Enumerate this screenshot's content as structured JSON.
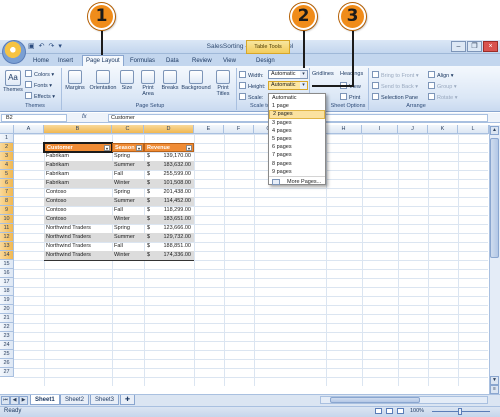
{
  "callouts": [
    "1",
    "2",
    "3"
  ],
  "window": {
    "title": "SalesSorting - Microsoft Excel",
    "context_tab": "Table Tools"
  },
  "tabs": [
    "Home",
    "Insert",
    "Page Layout",
    "Formulas",
    "Data",
    "Review",
    "View",
    "Design"
  ],
  "active_tab": "Page Layout",
  "ribbon": {
    "themes": {
      "themes_label": "Themes",
      "colors": "Colors",
      "fonts": "Fonts",
      "effects": "Effects",
      "group": "Themes"
    },
    "page_setup": {
      "margins": "Margins",
      "orientation": "Orientation",
      "size": "Size",
      "print_area": "Print Area",
      "breaks": "Breaks",
      "background": "Background",
      "print_titles": "Print Titles",
      "group": "Page Setup"
    },
    "scale": {
      "width_label": "Width:",
      "width_value": "Automatic",
      "height_label": "Height:",
      "height_value": "Automatic",
      "scale_label": "Scale:",
      "group": "Scale to Fit"
    },
    "sheet_options": {
      "gridlines": "Gridlines",
      "headings": "Headings",
      "view": "View",
      "print": "Print",
      "group": "Sheet Options"
    },
    "arrange": {
      "bring_to_front": "Bring to Front",
      "send_to_back": "Send to Back",
      "selection_pane": "Selection Pane",
      "align": "Align",
      "group_btn": "Group",
      "rotate": "Rotate",
      "group": "Arrange"
    }
  },
  "height_dropdown": {
    "items": [
      "Automatic",
      "1 page",
      "2 pages",
      "3 pages",
      "4 pages",
      "5 pages",
      "6 pages",
      "7 pages",
      "8 pages",
      "9 pages"
    ],
    "highlighted": "2 pages",
    "more": "More Pages..."
  },
  "formula_bar": {
    "name_box": "B2",
    "fx": "fx",
    "content": "Customer"
  },
  "columns": [
    "A",
    "B",
    "C",
    "D",
    "E",
    "F",
    "G",
    "H",
    "I",
    "J",
    "K",
    "L"
  ],
  "rows": [
    "1",
    "2",
    "3",
    "4",
    "5",
    "6",
    "7",
    "8",
    "9",
    "10",
    "11",
    "12",
    "13",
    "14",
    "15",
    "16",
    "17",
    "18",
    "19",
    "20",
    "21",
    "22",
    "23",
    "24",
    "25",
    "26",
    "27"
  ],
  "table": {
    "headers": [
      "Customer",
      "Season",
      "Revenue"
    ],
    "currency": "$",
    "rows": [
      [
        "Fabrikam",
        "Spring",
        "139,170.00"
      ],
      [
        "Fabrikam",
        "Summer",
        "183,632.00"
      ],
      [
        "Fabrikam",
        "Fall",
        "255,599.00"
      ],
      [
        "Fabrikam",
        "Winter",
        "101,508.00"
      ],
      [
        "Contoso",
        "Spring",
        "201,438.00"
      ],
      [
        "Contoso",
        "Summer",
        "114,452.00"
      ],
      [
        "Contoso",
        "Fall",
        "118,299.00"
      ],
      [
        "Contoso",
        "Winter",
        "183,651.00"
      ],
      [
        "Northwind Traders",
        "Spring",
        "123,666.00"
      ],
      [
        "Northwind Traders",
        "Summer",
        "129,732.00"
      ],
      [
        "Northwind Traders",
        "Fall",
        "188,851.00"
      ],
      [
        "Northwind Traders",
        "Winter",
        "174,336.00"
      ]
    ]
  },
  "sheets": [
    "Sheet1",
    "Sheet2",
    "Sheet3"
  ],
  "active_sheet": "Sheet1",
  "status": {
    "ready": "Ready",
    "zoom": "100%"
  },
  "colors": {
    "header_orange": "#f08c35",
    "band_gray": "#dcdcdc",
    "callout_orange": "#f08c1a",
    "ribbon_blue": "#dbe7f6"
  }
}
